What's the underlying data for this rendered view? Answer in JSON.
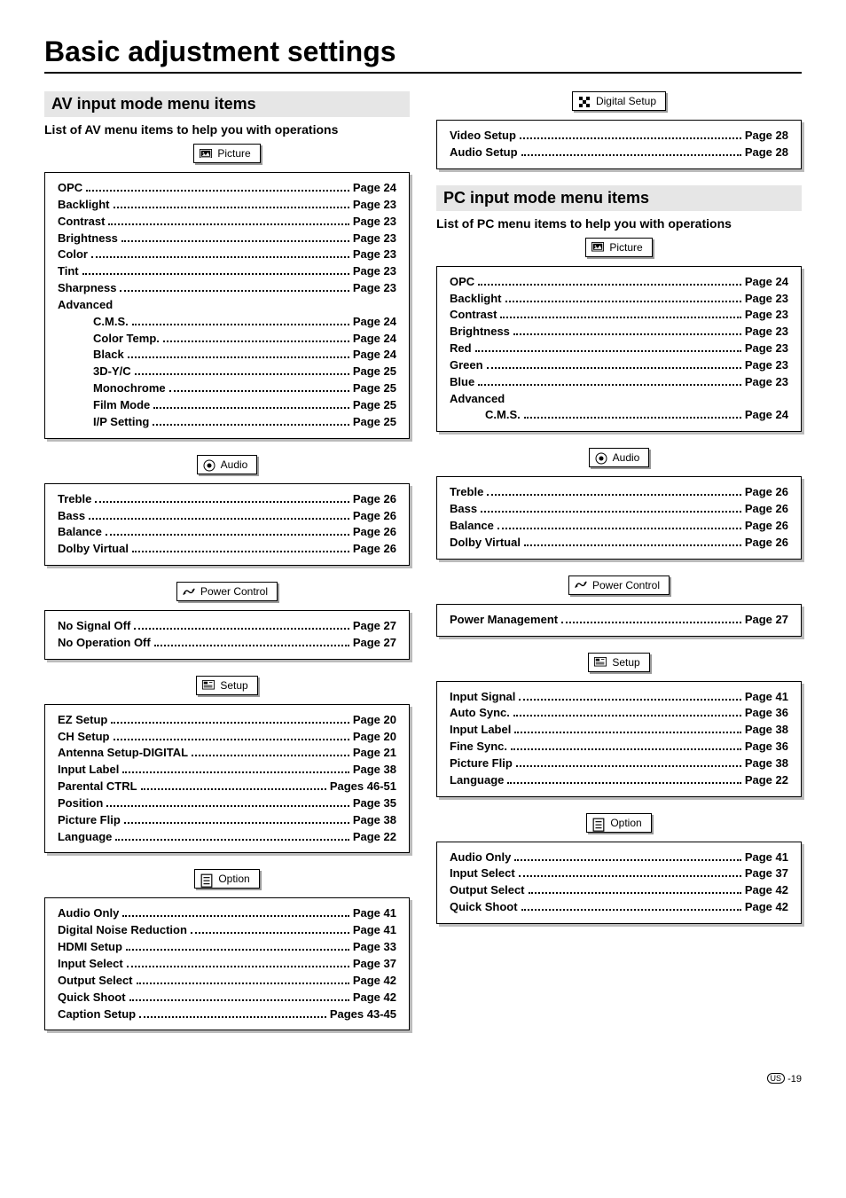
{
  "title": "Basic adjustment settings",
  "footer": {
    "region": "US",
    "page": "-19"
  },
  "left": {
    "heading": "AV input mode menu items",
    "sub": "List of AV menu items to help you with operations",
    "groups": [
      {
        "tab": {
          "icon": "picture-icon",
          "label": "Picture"
        },
        "items": [
          {
            "label": "OPC",
            "page": "Page 24"
          },
          {
            "label": "Backlight",
            "page": "Page 23"
          },
          {
            "label": "Contrast",
            "page": "Page 23"
          },
          {
            "label": "Brightness",
            "page": "Page 23"
          },
          {
            "label": "Color",
            "page": "Page 23"
          },
          {
            "label": "Tint",
            "page": "Page 23"
          },
          {
            "label": "Sharpness",
            "page": "Page 23"
          },
          {
            "label": "Advanced",
            "heading": true
          },
          {
            "label": "C.M.S.",
            "page": "Page 24",
            "indent": true
          },
          {
            "label": "Color Temp.",
            "page": "Page 24",
            "indent": true
          },
          {
            "label": "Black",
            "page": "Page 24",
            "indent": true
          },
          {
            "label": "3D-Y/C",
            "page": "Page 25",
            "indent": true
          },
          {
            "label": "Monochrome",
            "page": "Page 25",
            "indent": true
          },
          {
            "label": "Film Mode",
            "page": "Page 25",
            "indent": true
          },
          {
            "label": "I/P Setting",
            "page": "Page 25",
            "indent": true
          }
        ]
      },
      {
        "tab": {
          "icon": "audio-icon",
          "label": "Audio"
        },
        "items": [
          {
            "label": "Treble",
            "page": "Page 26"
          },
          {
            "label": "Bass",
            "page": "Page 26"
          },
          {
            "label": "Balance",
            "page": "Page 26"
          },
          {
            "label": "Dolby Virtual",
            "page": "Page 26"
          }
        ]
      },
      {
        "tab": {
          "icon": "power-icon",
          "label": "Power Control"
        },
        "items": [
          {
            "label": "No Signal Off",
            "page": "Page 27"
          },
          {
            "label": "No Operation Off",
            "page": "Page 27"
          }
        ]
      },
      {
        "tab": {
          "icon": "setup-icon",
          "label": "Setup"
        },
        "items": [
          {
            "label": "EZ Setup",
            "page": "Page 20"
          },
          {
            "label": "CH Setup",
            "page": "Page 20"
          },
          {
            "label": "Antenna Setup-DIGITAL",
            "page": "Page 21"
          },
          {
            "label": "Input Label",
            "page": "Page 38"
          },
          {
            "label": "Parental CTRL",
            "page": "Pages 46-51"
          },
          {
            "label": "Position",
            "page": "Page 35"
          },
          {
            "label": "Picture Flip",
            "page": "Page 38"
          },
          {
            "label": "Language",
            "page": "Page 22"
          }
        ]
      },
      {
        "tab": {
          "icon": "option-icon",
          "label": "Option"
        },
        "items": [
          {
            "label": "Audio Only",
            "page": "Page 41"
          },
          {
            "label": "Digital Noise Reduction",
            "page": "Page 41"
          },
          {
            "label": "HDMI Setup",
            "page": "Page 33"
          },
          {
            "label": "Input Select",
            "page": "Page 37"
          },
          {
            "label": "Output Select",
            "page": "Page 42"
          },
          {
            "label": "Quick Shoot",
            "page": "Page 42"
          },
          {
            "label": "Caption Setup",
            "page": "Pages 43-45"
          }
        ]
      }
    ]
  },
  "right": {
    "pregroups": [
      {
        "tab": {
          "icon": "digital-icon",
          "label": "Digital Setup"
        },
        "items": [
          {
            "label": "Video Setup",
            "page": "Page 28"
          },
          {
            "label": "Audio Setup",
            "page": "Page 28"
          }
        ]
      }
    ],
    "heading": "PC input mode menu items",
    "sub": "List of PC menu items to help you with operations",
    "groups": [
      {
        "tab": {
          "icon": "picture-icon",
          "label": "Picture"
        },
        "items": [
          {
            "label": "OPC",
            "page": "Page 24"
          },
          {
            "label": "Backlight",
            "page": "Page 23"
          },
          {
            "label": "Contrast",
            "page": "Page 23"
          },
          {
            "label": "Brightness",
            "page": "Page 23"
          },
          {
            "label": "Red",
            "page": "Page 23"
          },
          {
            "label": "Green",
            "page": "Page 23"
          },
          {
            "label": "Blue",
            "page": "Page 23"
          },
          {
            "label": "Advanced",
            "heading": true
          },
          {
            "label": "C.M.S.",
            "page": "Page 24",
            "indent": true
          }
        ]
      },
      {
        "tab": {
          "icon": "audio-icon",
          "label": "Audio"
        },
        "items": [
          {
            "label": "Treble",
            "page": "Page 26"
          },
          {
            "label": "Bass",
            "page": "Page 26"
          },
          {
            "label": "Balance",
            "page": "Page 26"
          },
          {
            "label": "Dolby Virtual",
            "page": "Page 26"
          }
        ]
      },
      {
        "tab": {
          "icon": "power-icon",
          "label": "Power Control"
        },
        "items": [
          {
            "label": "Power Management",
            "page": "Page 27"
          }
        ]
      },
      {
        "tab": {
          "icon": "setup-icon",
          "label": "Setup"
        },
        "items": [
          {
            "label": "Input Signal",
            "page": "Page 41"
          },
          {
            "label": "Auto Sync.",
            "page": "Page 36"
          },
          {
            "label": "Input Label",
            "page": "Page 38"
          },
          {
            "label": "Fine Sync.",
            "page": "Page 36"
          },
          {
            "label": "Picture Flip",
            "page": "Page 38"
          },
          {
            "label": "Language",
            "page": "Page 22"
          }
        ]
      },
      {
        "tab": {
          "icon": "option-icon",
          "label": "Option"
        },
        "items": [
          {
            "label": "Audio Only",
            "page": "Page 41"
          },
          {
            "label": "Input Select",
            "page": "Page 37"
          },
          {
            "label": "Output Select",
            "page": "Page 42"
          },
          {
            "label": "Quick Shoot",
            "page": "Page 42"
          }
        ]
      }
    ]
  }
}
